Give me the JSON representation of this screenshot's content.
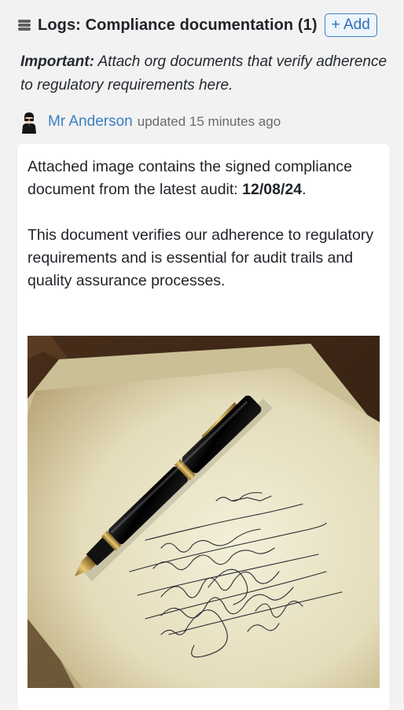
{
  "header": {
    "icon": "list-icon",
    "title": "Logs: Compliance documentation (1)",
    "add_label": "+ Add"
  },
  "notice": {
    "emphasis": "Important:",
    "text": " Attach org documents that verify adherence to regulatory requirements here."
  },
  "entry": {
    "author": "Mr Anderson",
    "updated_text": "updated 15 minutes ago",
    "paragraph1_prefix": "Attached image contains the signed compliance document from the latest audit: ",
    "paragraph1_date": "12/08/24",
    "paragraph1_suffix": ".",
    "paragraph2": "This document verifies our adherence to regulatory requirements and is essential for audit trails and quality assurance processes.",
    "image_icon": "signed-document-photo"
  },
  "colors": {
    "link": "#3c7fc3",
    "button_border": "#3f7fc4",
    "background": "#f2f2f2",
    "card": "#ffffff"
  }
}
